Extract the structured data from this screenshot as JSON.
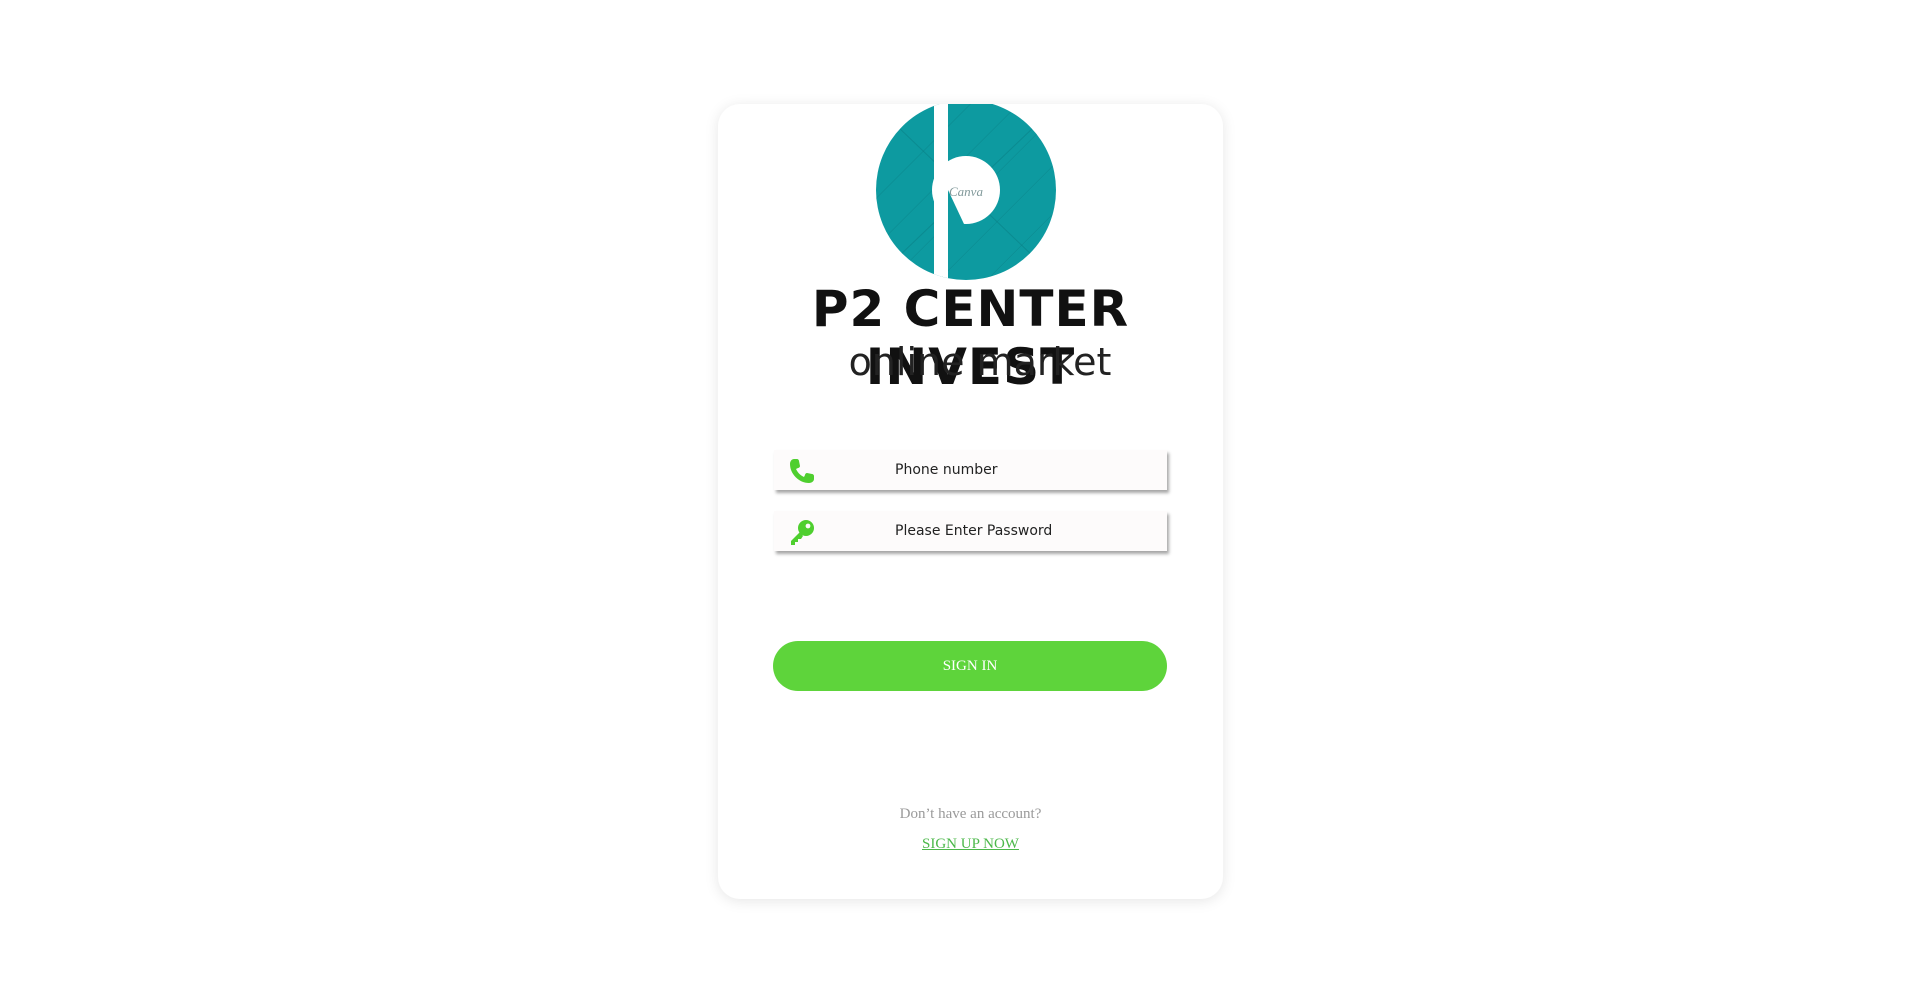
{
  "brand": {
    "title": "P2 CENTER INVEST",
    "subtitle": "online market",
    "watermark": "Canva",
    "logo_color": "#0d9aa0"
  },
  "form": {
    "phone": {
      "icon": "phone-icon",
      "placeholder": "Phone number"
    },
    "password": {
      "icon": "key-icon",
      "placeholder": "Please Enter Password"
    },
    "icon_color": "#4fcf2f"
  },
  "actions": {
    "signin_label": "SIGN IN",
    "signin_color": "#5ed43b",
    "no_account_text": "Don’t have an account?",
    "signup_label": "SIGN UP NOW",
    "signup_color": "#4cb84a"
  }
}
